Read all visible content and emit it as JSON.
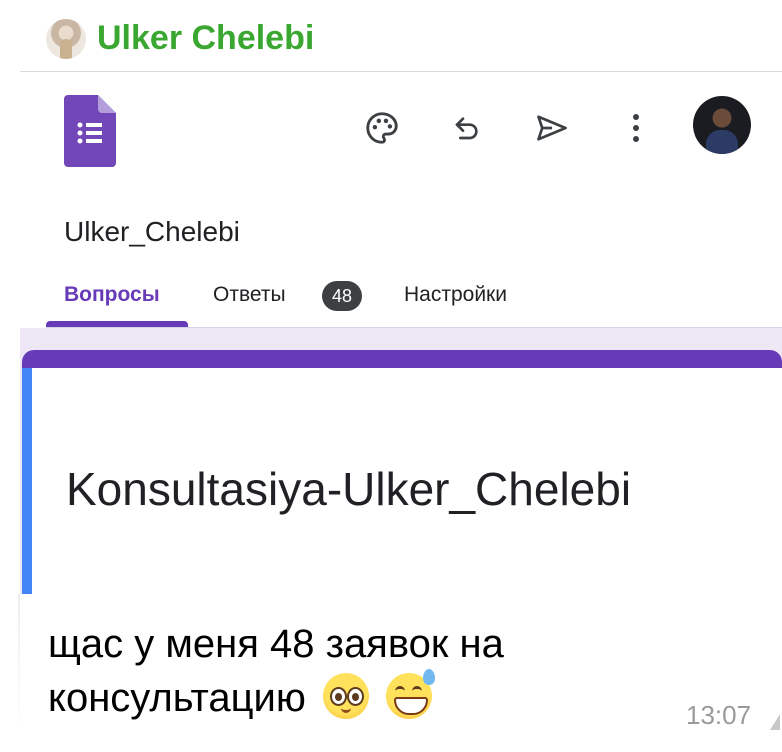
{
  "chat": {
    "sender_name": "Ulker Chelebi",
    "sender_color": "#3aa830"
  },
  "forms_screenshot": {
    "app_icon": "google-forms-icon",
    "toolbar_icons": [
      "palette-icon",
      "undo-icon",
      "send-icon",
      "more-vert-icon",
      "account-avatar"
    ],
    "form_name": "Ulker_Chelebi",
    "tabs": [
      {
        "label": "Вопросы",
        "active": true
      },
      {
        "label": "Ответы",
        "badge": "48"
      },
      {
        "label": "Настройки"
      }
    ],
    "form_title": "Konsultasiya-Ulker_Chelebi",
    "theme_color": "#673ab7",
    "accent_bar_color": "#4285f4"
  },
  "message": {
    "text": "щас у меня 48 заявок на консультацию",
    "emojis": [
      "pleading-face-icon",
      "grinning-sweat-face-icon"
    ],
    "time": "13:07"
  }
}
